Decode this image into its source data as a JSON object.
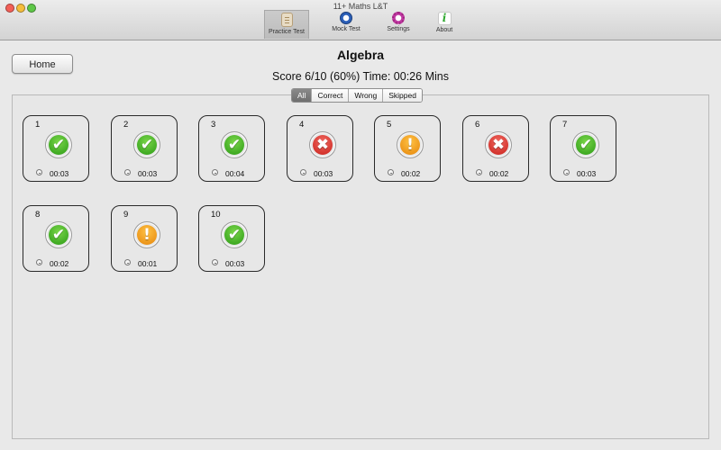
{
  "window": {
    "title": "11+ Maths L&T"
  },
  "toolbar": {
    "items": [
      {
        "label": "Practice Test",
        "icon": "practice-test-icon",
        "selected": true
      },
      {
        "label": "Mock Test",
        "icon": "mock-test-icon",
        "selected": false
      },
      {
        "label": "Settings",
        "icon": "settings-icon",
        "selected": false
      },
      {
        "label": "About",
        "icon": "about-icon",
        "glyph": "i",
        "selected": false
      }
    ]
  },
  "header": {
    "home_label": "Home",
    "title": "Algebra",
    "score_text": "Score 6/10 (60%) Time: 00:26 Mins"
  },
  "filter": {
    "options": [
      "All",
      "Correct",
      "Wrong",
      "Skipped"
    ],
    "selected": "All"
  },
  "status_colors": {
    "correct": "#3cae1e",
    "wrong": "#d9312a",
    "skipped": "#f2a019"
  },
  "questions": [
    {
      "number": "1",
      "status": "correct",
      "time": "00:03"
    },
    {
      "number": "2",
      "status": "correct",
      "time": "00:03"
    },
    {
      "number": "3",
      "status": "correct",
      "time": "00:04"
    },
    {
      "number": "4",
      "status": "wrong",
      "time": "00:03"
    },
    {
      "number": "5",
      "status": "skipped",
      "time": "00:02"
    },
    {
      "number": "6",
      "status": "wrong",
      "time": "00:02"
    },
    {
      "number": "7",
      "status": "correct",
      "time": "00:03"
    },
    {
      "number": "8",
      "status": "correct",
      "time": "00:02"
    },
    {
      "number": "9",
      "status": "skipped",
      "time": "00:01"
    },
    {
      "number": "10",
      "status": "correct",
      "time": "00:03"
    }
  ]
}
